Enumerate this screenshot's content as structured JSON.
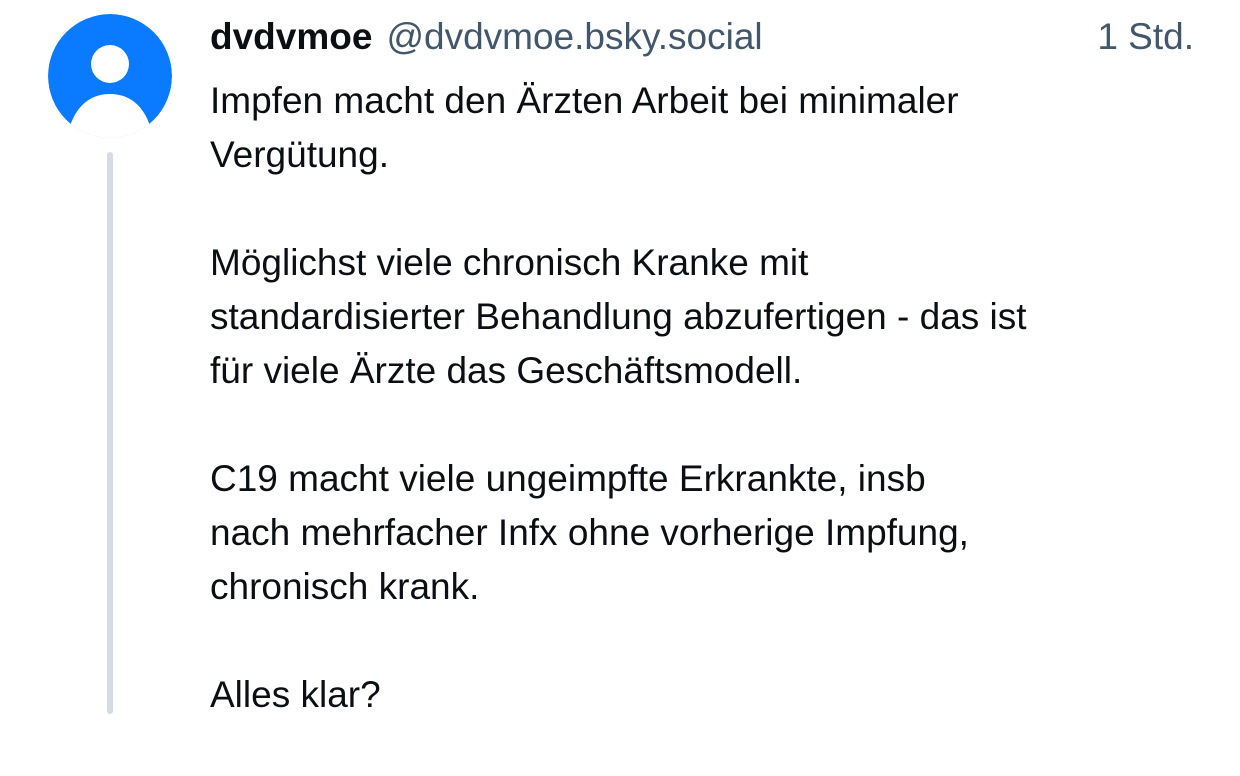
{
  "post": {
    "author": {
      "display_name": "dvdvmoe",
      "handle": "@dvdvmoe.bsky.social",
      "avatar_icon": "default-user-avatar-icon",
      "avatar_color": "#0a7aff"
    },
    "timestamp": "1 Std.",
    "paragraphs": [
      "Impfen macht den Ärzten Arbeit bei minimaler\nVergütung.",
      "Möglichst viele chronisch Kranke mit\nstandardisierter Behandlung abzufertigen - das ist\nfür viele Ärzte das Geschäftsmodell.",
      "C19 macht viele ungeimpfte Erkrankte, insb\nnach mehrfacher Infx ohne vorherige Impfung,\nchronisch krank.",
      "Alles klar?"
    ]
  },
  "colors": {
    "thread_line": "#d4dbe2",
    "secondary_text": "#42576c",
    "primary_text": "#0b0f14"
  }
}
